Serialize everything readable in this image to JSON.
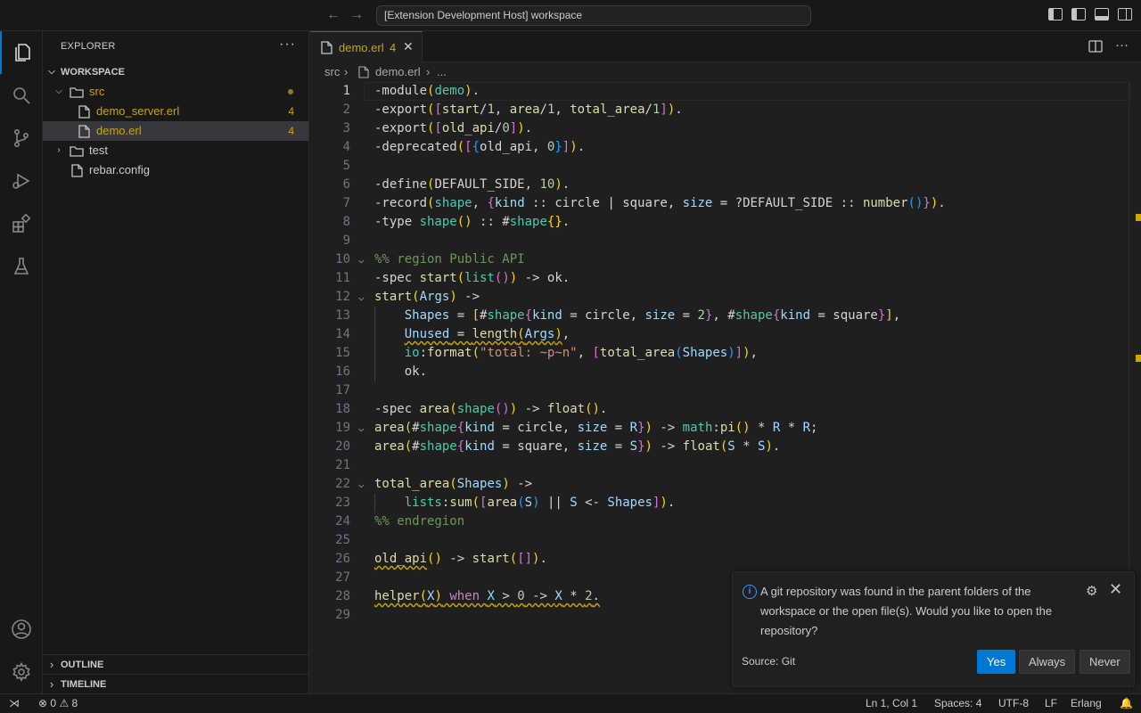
{
  "titlebar": {
    "back_label": "←",
    "forward_label": "→",
    "command_center": "[Extension Development Host] workspace"
  },
  "sidebar": {
    "title": "EXPLORER",
    "more": "···",
    "workspace": "WORKSPACE",
    "folder_src": "src",
    "file_demo_server": "demo_server.erl",
    "file_demo_server_badge": "4",
    "file_demo": "demo.erl",
    "file_demo_badge": "4",
    "folder_test": "test",
    "file_rebar": "rebar.config",
    "outline": "OUTLINE",
    "timeline": "TIMELINE"
  },
  "tab": {
    "label": "demo.erl",
    "count": "4",
    "close": "✕"
  },
  "breadcrumb": {
    "folder": "src",
    "file": "demo.erl",
    "more": "..."
  },
  "editor": {
    "line_numbers": [
      "1",
      "2",
      "3",
      "4",
      "5",
      "6",
      "7",
      "8",
      "9",
      "10",
      "11",
      "12",
      "13",
      "14",
      "15",
      "16",
      "17",
      "18",
      "19",
      "20",
      "21",
      "22",
      "23",
      "24",
      "25",
      "26",
      "27",
      "28",
      "29"
    ]
  },
  "notification": {
    "info_icon": "i",
    "message": "A git repository was found in the parent folders of the workspace or the open file(s). Would you like to open the repository?",
    "source": "Source: Git",
    "yes": "Yes",
    "always": "Always",
    "never": "Never"
  },
  "statusbar": {
    "errors": "0",
    "warnings": "8",
    "position": "Ln 1, Col 1",
    "spaces": "Spaces: 4",
    "encoding": "UTF-8",
    "eol": "LF",
    "language": "Erlang"
  },
  "colors": {
    "accent": "#0078d4",
    "warning": "#cca700",
    "background": "#1f1f1f"
  }
}
